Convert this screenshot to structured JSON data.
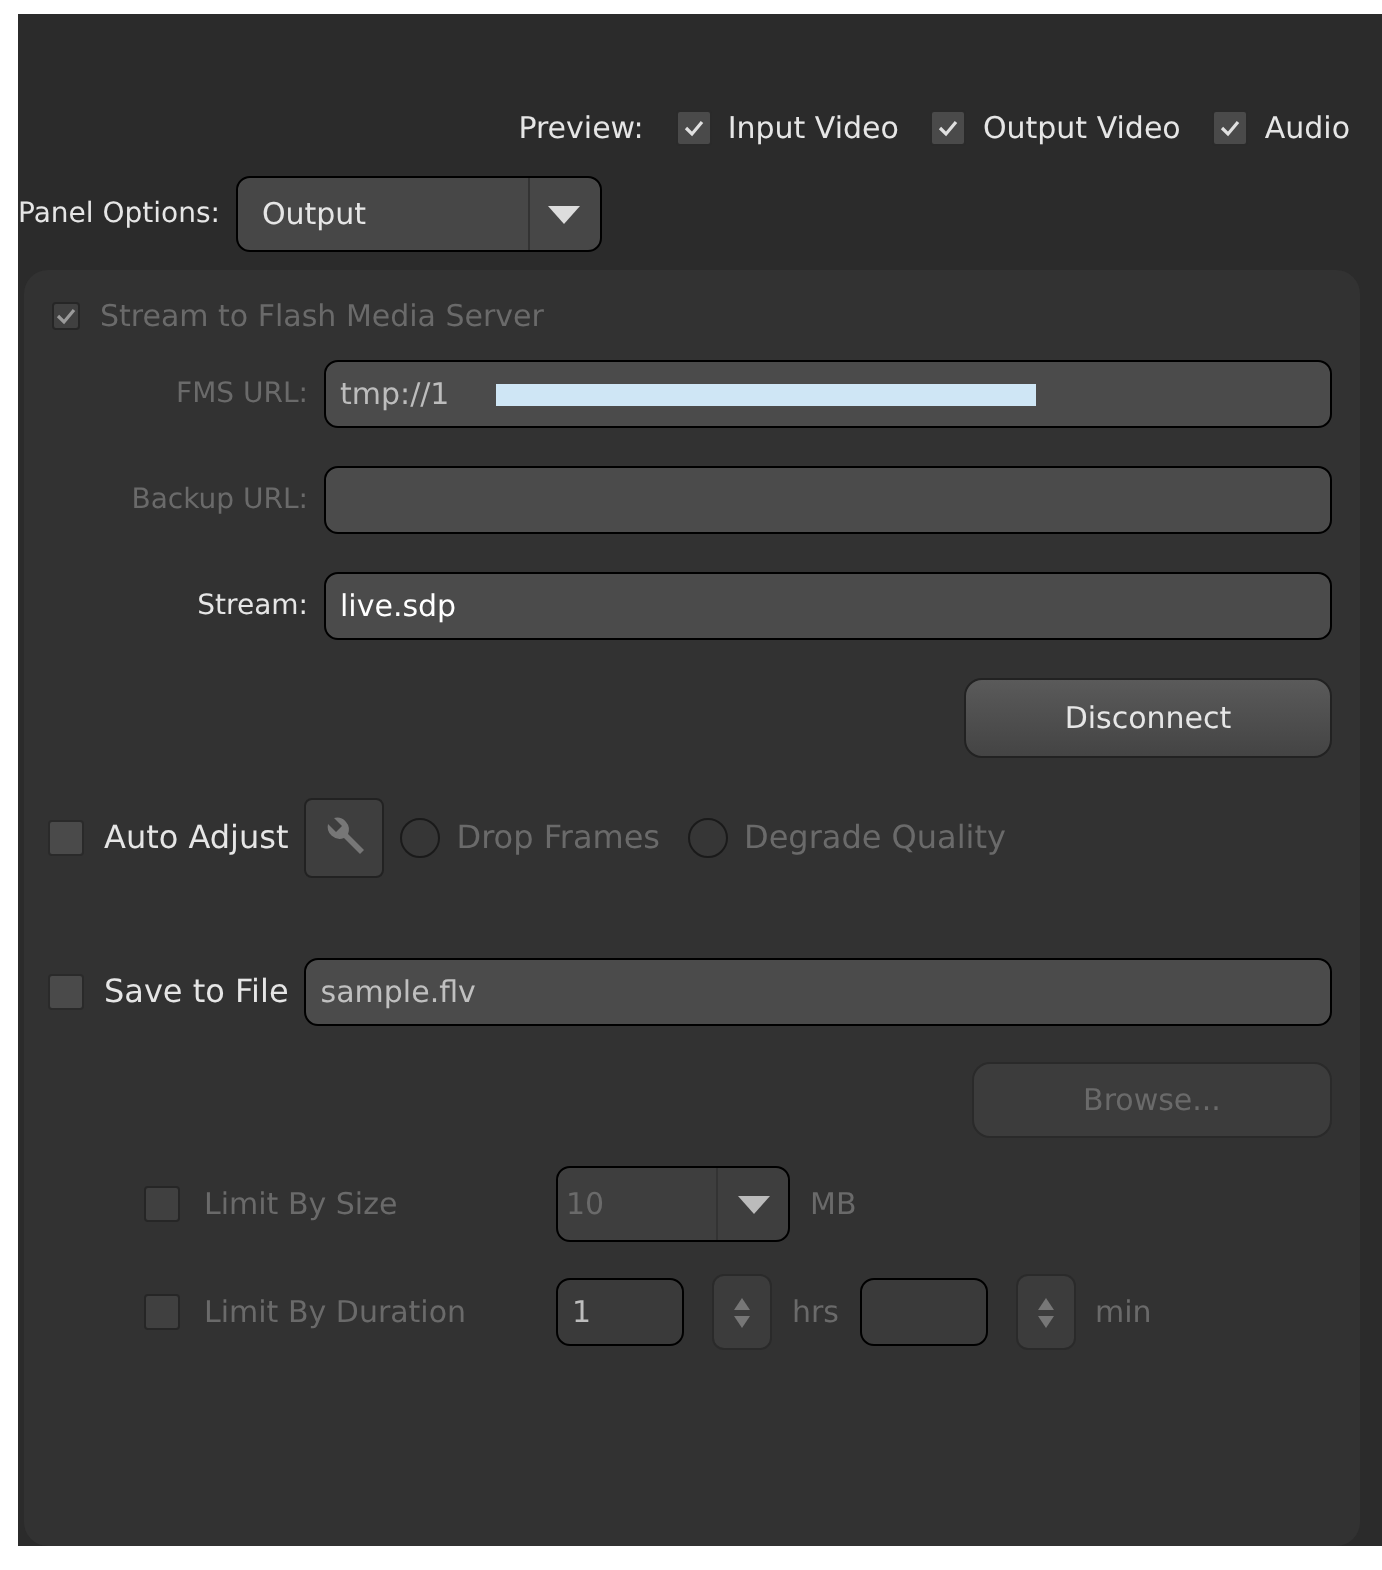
{
  "preview": {
    "label": "Preview:",
    "options": [
      {
        "label": "Input Video",
        "checked": true
      },
      {
        "label": "Output Video",
        "checked": true
      },
      {
        "label": "Audio",
        "checked": true
      }
    ]
  },
  "panel_options": {
    "label": "Panel Options:",
    "value": "Output"
  },
  "stream": {
    "label": "Stream to Flash Media Server",
    "checked": true,
    "disabled": true,
    "fields": [
      {
        "label": "FMS URL:",
        "value": "tmp://1",
        "disabled": true,
        "redacted": true
      },
      {
        "label": "Backup URL:",
        "disabled": true,
        "redacted": false
      },
      {
        "label": "Stream:",
        "value": "live.sdp",
        "disabled": false,
        "redacted": false
      }
    ],
    "button": {
      "label": "Disconnect",
      "disabled": false
    }
  },
  "auto_adjust": {
    "label": "Auto Adjust",
    "checked": false,
    "disabled": false,
    "radios": [
      {
        "label": "Drop Frames",
        "selected": false,
        "disabled": true
      },
      {
        "label": "Degrade Quality",
        "selected": false,
        "disabled": true
      }
    ]
  },
  "save_to_file": {
    "label": "Save to File",
    "checked": false,
    "disabled": false,
    "placeholder": "sample.flv",
    "button": {
      "label": "Browse...",
      "disabled": true
    },
    "limit_size": {
      "label": "Limit By Size",
      "checked": false,
      "disabled": true,
      "value": "10",
      "unit": "MB"
    },
    "limit_duration": {
      "label": "Limit By Duration",
      "checked": false,
      "disabled": true,
      "hours": "1",
      "hours_unit": "hrs",
      "minutes_unit": "min"
    }
  }
}
